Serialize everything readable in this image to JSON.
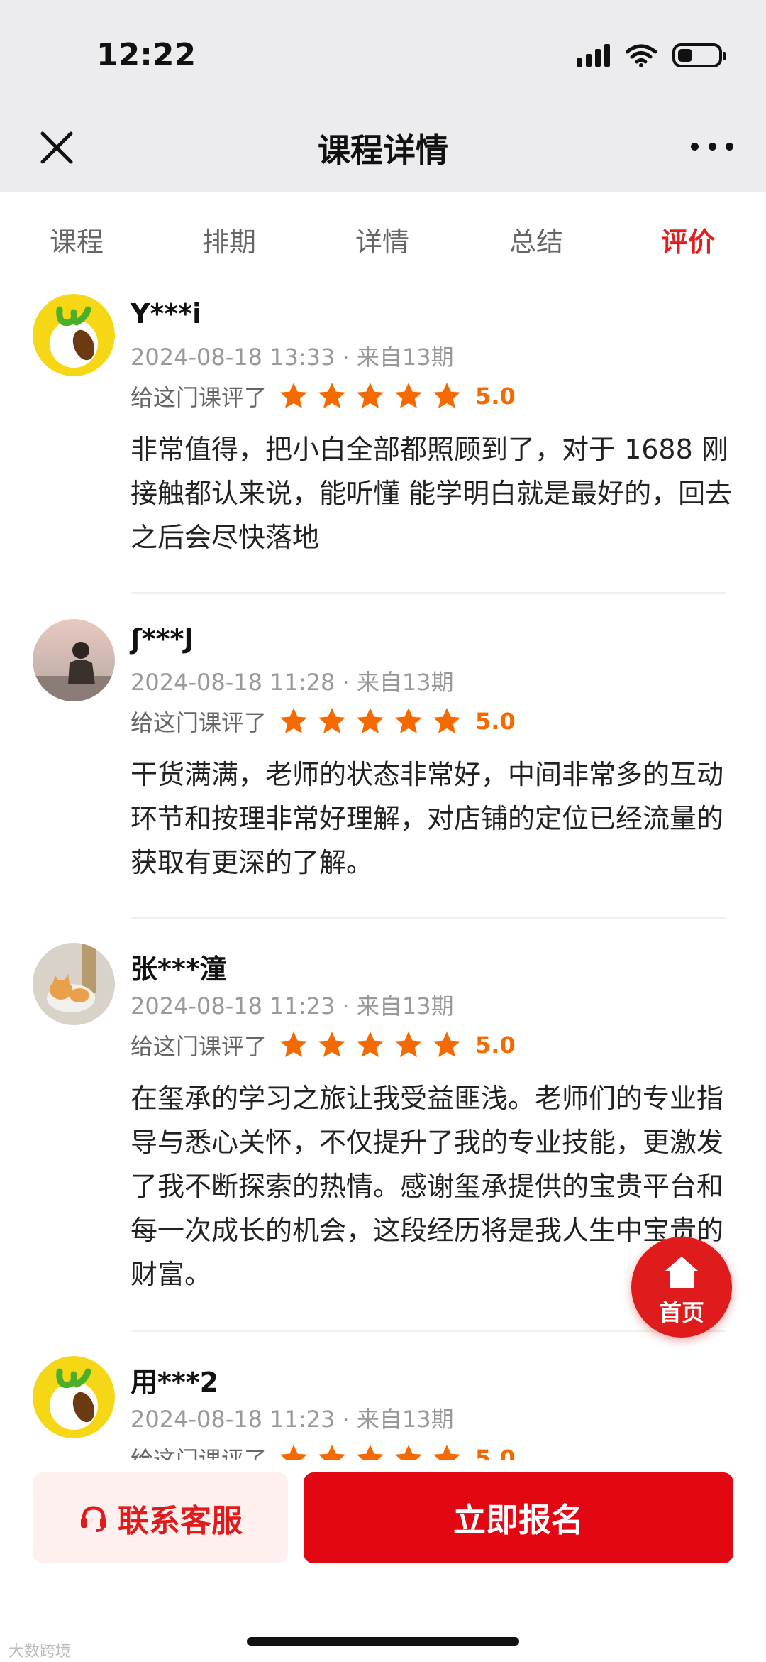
{
  "status": {
    "time": "12:22"
  },
  "nav": {
    "title": "课程详情"
  },
  "tabs": [
    {
      "label": "课程"
    },
    {
      "label": "排期"
    },
    {
      "label": "详情"
    },
    {
      "label": "总结"
    },
    {
      "label": "评价",
      "active": true
    }
  ],
  "reviews": [
    {
      "name": "Y***i",
      "meta": "2024-08-18 13:33 · 来自13期",
      "rate_label": "给这门课评了",
      "stars": 5,
      "score": "5.0",
      "text": "非常值得，把小白全部都照顾到了，对于 1688 刚接触都认来说，能听懂 能学明白就是最好的，回去之后会尽快落地",
      "avatar": "lemon-logo-avatar"
    },
    {
      "name": "ʃ***J",
      "meta": "2024-08-18 11:28 · 来自13期",
      "rate_label": "给这门课评了",
      "stars": 5,
      "score": "5.0",
      "text": "干货满满，老师的状态非常好，中间非常多的互动环节和按理非常好理解，对店铺的定位已经流量的获取有更深的了解。",
      "avatar": "person-sitting-avatar"
    },
    {
      "name": "张***潼",
      "meta": "2024-08-18 11:23 · 来自13期",
      "rate_label": "给这门课评了",
      "stars": 5,
      "score": "5.0",
      "text": "在玺承的学习之旅让我受益匪浅。老师们的专业指导与悉心关怀，不仅提升了我的专业技能，更激发了我不断探索的热情。感谢玺承提供的宝贵平台和每一次成长的机会，这段经历将是我人生中宝贵的财富。",
      "avatar": "cat-avatar"
    },
    {
      "name": "用***2",
      "meta": "2024-08-18 11:23 · 来自13期",
      "rate_label": "给这门课评了",
      "stars": 5,
      "score": "5.0",
      "text": "",
      "avatar": "lemon-logo-avatar"
    }
  ],
  "fab": {
    "label": "首页"
  },
  "bottom": {
    "service_label": "联系客服",
    "signup_label": "立即报名"
  },
  "watermark": "大数跨境",
  "colors": {
    "accent": "#e30613",
    "star": "#f56a00",
    "tab_active": "#e02020"
  }
}
